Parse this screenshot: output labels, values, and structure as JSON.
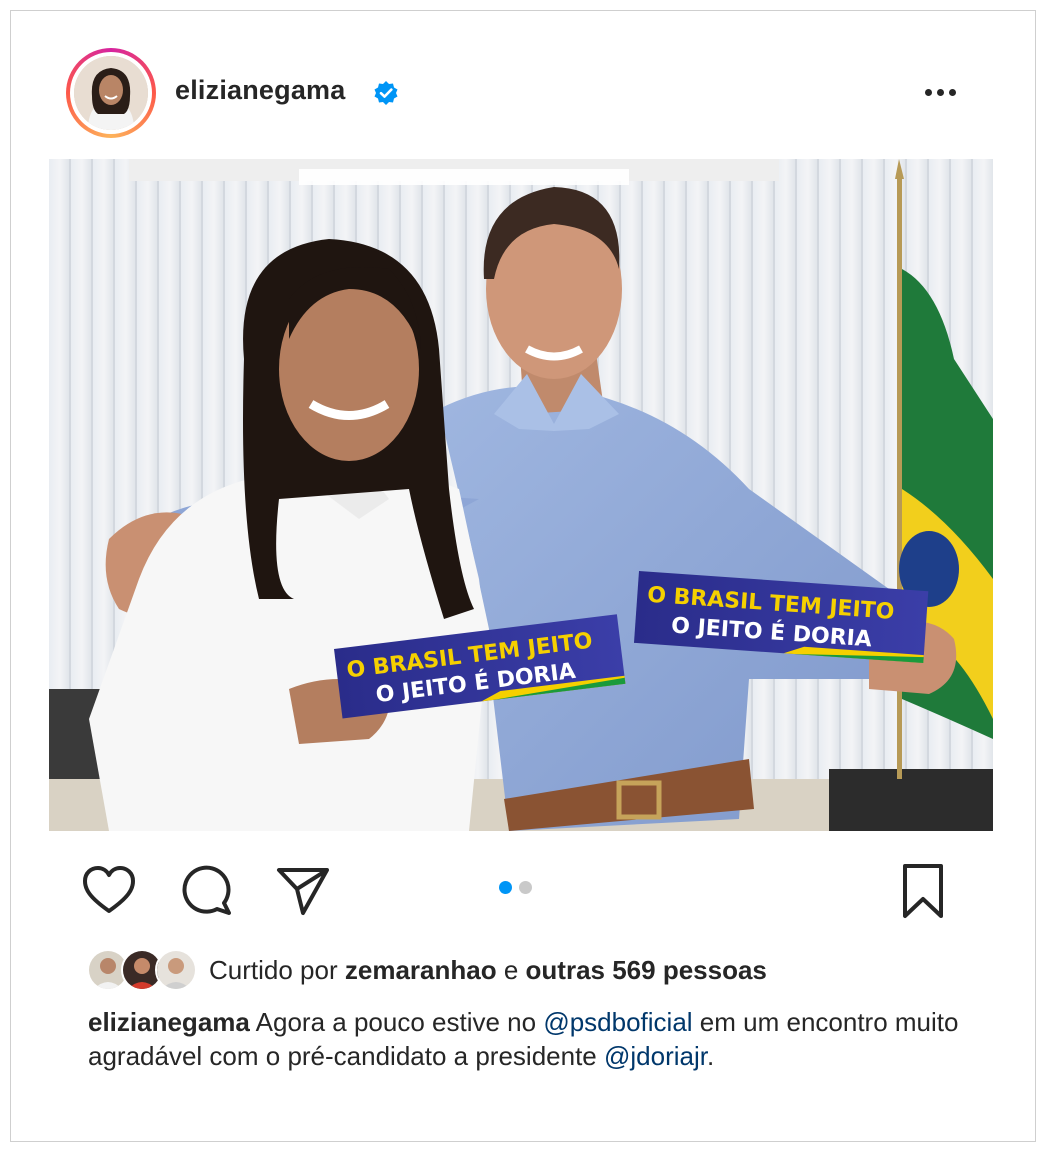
{
  "post": {
    "username": "elizianegama",
    "verified_icon": "verified-badge-icon",
    "more_icon": "more-options-icon"
  },
  "photo": {
    "sticker_left": {
      "line1": "O BRASIL TEM JEITO",
      "line2": "O JEITO É DORIA"
    },
    "sticker_right": {
      "line1": "O BRASIL TEM JEITO",
      "line2": "O JEITO É DORIA"
    }
  },
  "actions": {
    "like_icon": "heart-icon",
    "comment_icon": "comment-icon",
    "share_icon": "send-icon",
    "save_icon": "bookmark-icon",
    "carousel_current": 1,
    "carousel_total": 2
  },
  "likes": {
    "prefix": "Curtido por",
    "user": "zemaranhao",
    "connector": "e",
    "others": "outras 569 pessoas"
  },
  "caption": {
    "username": "elizianegama",
    "text1": "Agora a pouco estive no",
    "mention1": "@psdboficial",
    "text2": "em um encontro muito agradável com o pré-candidato a presidente",
    "mention2": "@jdoriajr",
    "text3": "."
  },
  "colors": {
    "accent_blue": "#0095f6",
    "mention_blue": "#00376b",
    "sticker_navy": "#2c2f8f",
    "sticker_yellow": "#f5d000",
    "sticker_green": "#1a9a3c"
  }
}
